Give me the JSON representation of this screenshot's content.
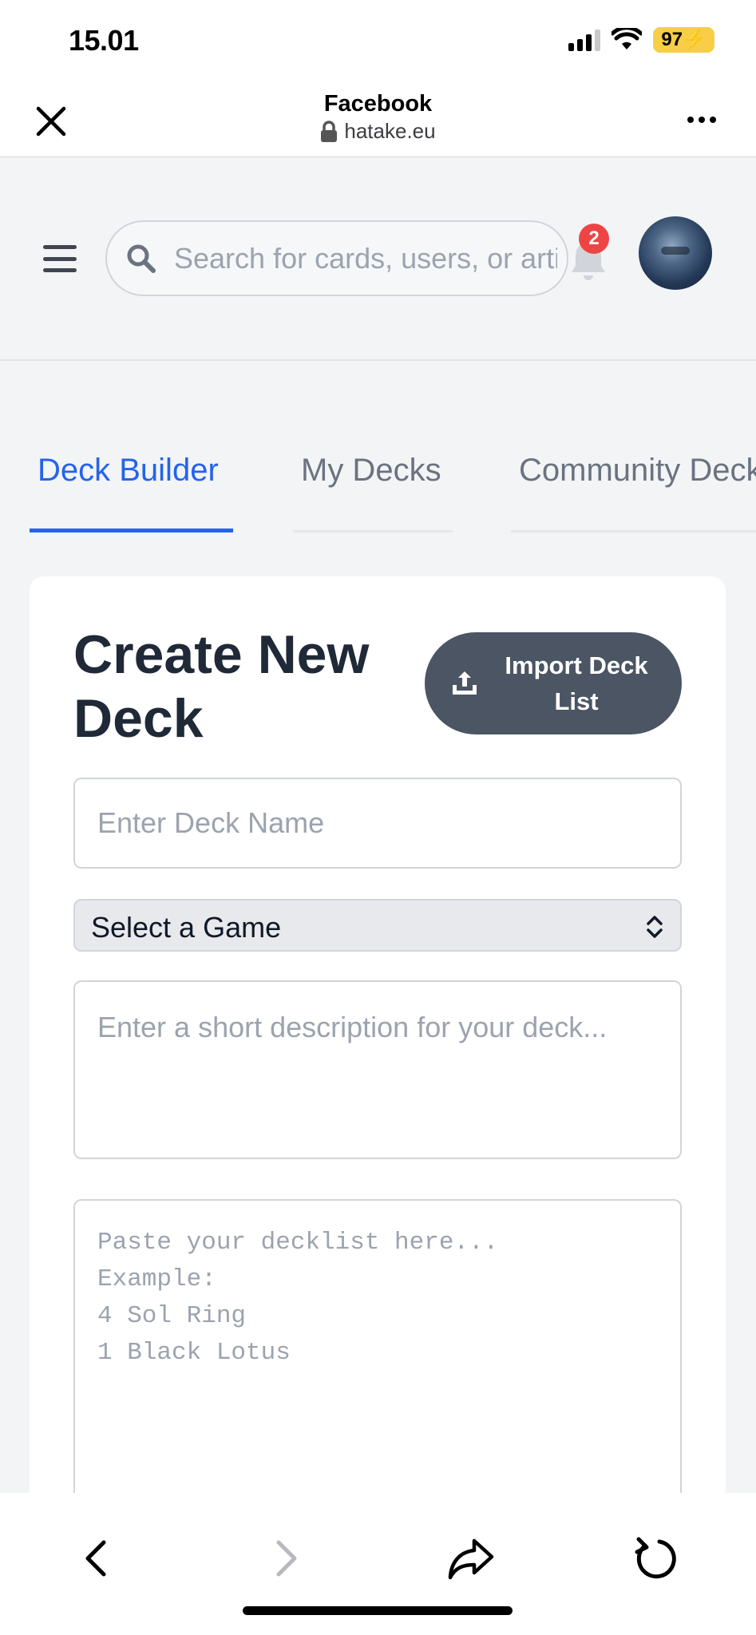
{
  "status_bar": {
    "time": "15.01",
    "battery": "97"
  },
  "browser": {
    "title": "Facebook",
    "url": "hatake.eu"
  },
  "header": {
    "search_placeholder": "Search for cards, users, or articles...",
    "notification_count": "2"
  },
  "tabs": [
    {
      "label": "Deck Builder",
      "active": true
    },
    {
      "label": "My Decks",
      "active": false
    },
    {
      "label": "Community Decks",
      "active": false
    }
  ],
  "form": {
    "title": "Create New Deck",
    "import_button": "Import Deck List",
    "deck_name_placeholder": "Enter Deck Name",
    "game_select_value": "Select a Game",
    "description_placeholder": "Enter a short description for your deck...",
    "decklist_placeholder": "Paste your decklist here...\nExample:\n4 Sol Ring\n1 Black Lotus"
  },
  "colors": {
    "accent": "#2563eb",
    "badge": "#ef4444",
    "button_dark": "#4b5563",
    "page_background": "#f3f4f6"
  },
  "icons": [
    "close-icon",
    "lock-icon",
    "more-icon",
    "menu-icon",
    "search-icon",
    "bell-icon",
    "upload-icon",
    "chevron-updown-icon",
    "back-icon",
    "forward-icon",
    "share-icon",
    "reload-icon"
  ]
}
